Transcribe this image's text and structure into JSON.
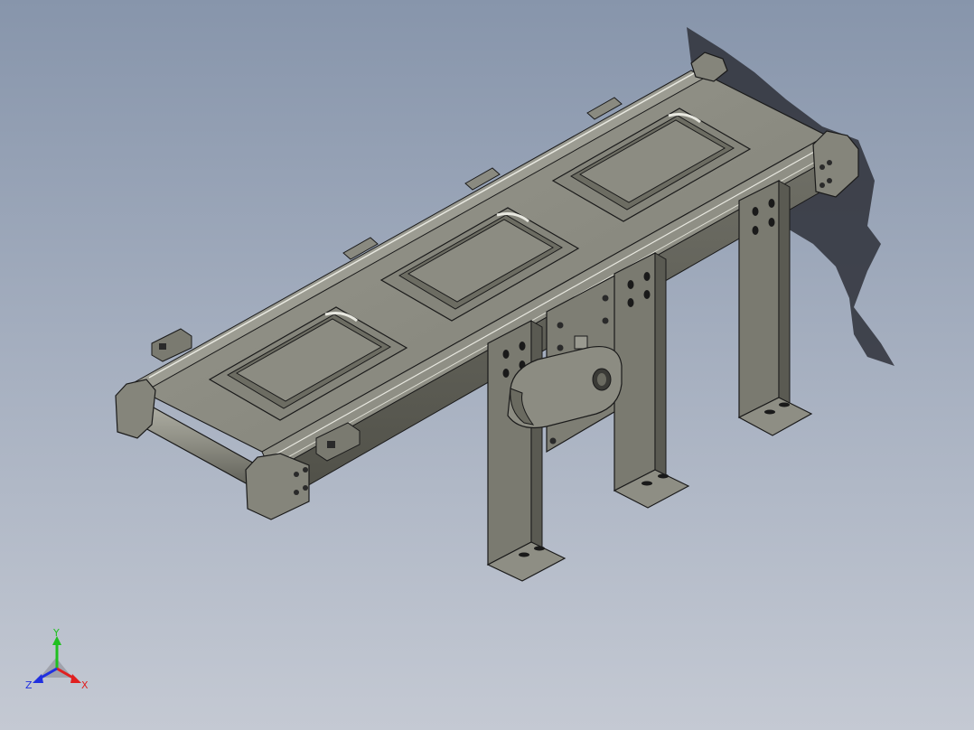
{
  "viewport": {
    "background_top": "#8795ab",
    "background_bottom": "#c4c9d3"
  },
  "model": {
    "description": "belt-conveyor-assembly",
    "fixture_count": 3,
    "support_leg_count": 3,
    "part_color": "#8a8a80",
    "part_edge_color": "#1a1a1a",
    "shadow_color": "#2e3038"
  },
  "triad": {
    "x_label": "X",
    "y_label": "Y",
    "z_label": "Z",
    "x_color": "#e02020",
    "y_color": "#20c020",
    "z_color": "#2030e0"
  }
}
